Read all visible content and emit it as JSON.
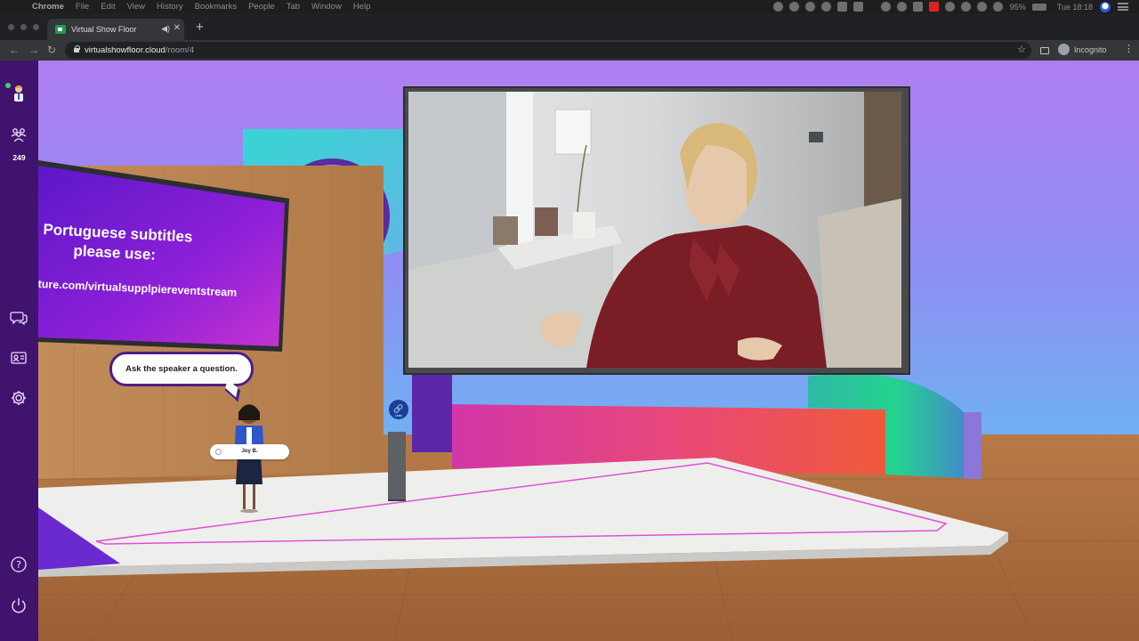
{
  "menubar": {
    "items": [
      "Chrome",
      "File",
      "Edit",
      "View",
      "History",
      "Bookmarks",
      "People",
      "Tab",
      "Window",
      "Help"
    ],
    "battery": "95%",
    "clock": "Tue 18:18"
  },
  "browser": {
    "tab_title": "Virtual Show Floor",
    "url_host": "virtualshowfloor.cloud",
    "url_path": "/room/4",
    "profile_label": "Incognito"
  },
  "sidebar": {
    "attendee_count": "249"
  },
  "scene": {
    "slide_line1": "Portuguese subtitles",
    "slide_line2": "please use:",
    "slide_line3": "ture.com/virtualsupplpiereventstream",
    "speech_bubble": "Ask the speaker a question.",
    "avatar_name": "Joy B.",
    "link_badge": "Links"
  },
  "colors": {
    "sidebar": "#40136f",
    "sky_top": "#b07ef0",
    "sky_bottom": "#6fb2f2",
    "floor": "#a96b3e",
    "stage": "#eeeeec",
    "stage_outline": "#e050d8"
  }
}
